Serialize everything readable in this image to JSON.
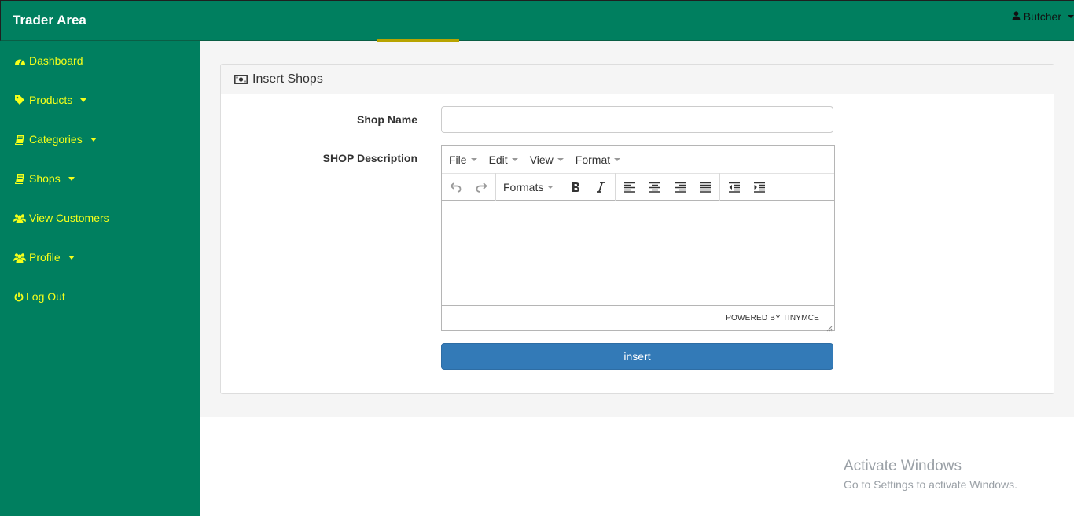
{
  "header": {
    "brand": "Trader Area",
    "user": "Butcher"
  },
  "sidebar": {
    "items": [
      {
        "label": "Dashboard",
        "icon": "dashboard-icon",
        "has_caret": false
      },
      {
        "label": "Products",
        "icon": "tag-icon",
        "has_caret": true
      },
      {
        "label": "Categories",
        "icon": "book-icon",
        "has_caret": true
      },
      {
        "label": "Shops",
        "icon": "book-icon",
        "has_caret": true
      },
      {
        "label": "View Customers",
        "icon": "users-icon",
        "has_caret": false
      },
      {
        "label": "Profile",
        "icon": "users-icon",
        "has_caret": true
      },
      {
        "label": "Log Out",
        "icon": "power-icon",
        "has_caret": false
      }
    ]
  },
  "panel": {
    "title": "Insert Shops",
    "icon": "money-icon"
  },
  "form": {
    "shop_name_label": "Shop Name",
    "shop_name_value": "",
    "description_label": "SHOP Description",
    "submit_label": "insert"
  },
  "editor": {
    "menus": [
      "File",
      "Edit",
      "View",
      "Format"
    ],
    "formats_label": "Formats",
    "powered_by": "POWERED BY TINYMCE"
  },
  "watermark": {
    "title": "Activate Windows",
    "subtitle": "Go to Settings to activate Windows."
  },
  "colors": {
    "nav_bg": "#007f5f",
    "nav_text": "#f5ff1a",
    "primary": "#337ab7"
  }
}
